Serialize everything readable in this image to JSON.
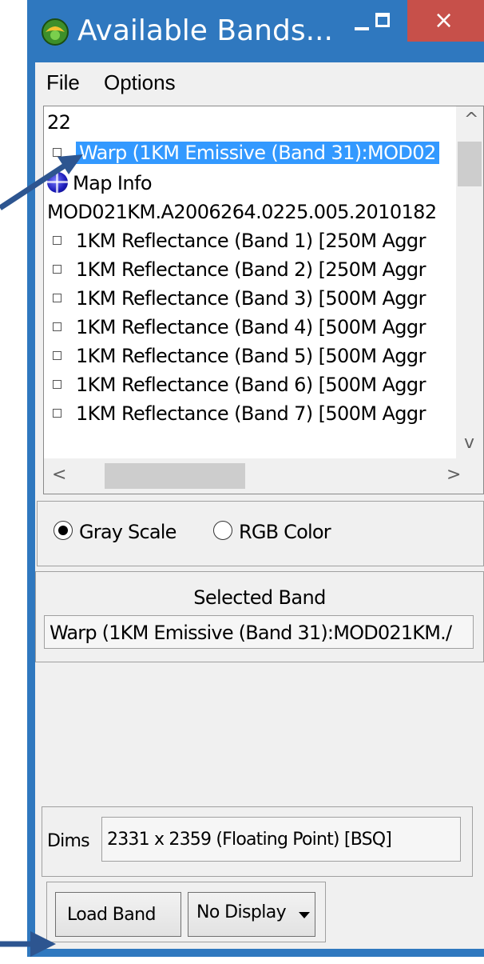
{
  "window": {
    "title": "Available Bands...",
    "close_glyph": "×"
  },
  "menu": {
    "file": "File",
    "options": "Options"
  },
  "band_list": {
    "header": "22",
    "selected_item": "Warp (1KM Emissive (Band 31):MOD02",
    "map_info": "Map Info",
    "file_node": "MOD021KM.A2006264.0225.005.2010182",
    "bands": [
      "1KM Reflectance (Band 1) [250M Aggr",
      "1KM Reflectance (Band 2) [250M Aggr",
      "1KM Reflectance (Band 3) [500M Aggr",
      "1KM Reflectance (Band 4) [500M Aggr",
      "1KM Reflectance (Band 5) [500M Aggr",
      "1KM Reflectance (Band 6) [500M Aggr",
      "1KM Reflectance (Band 7) [500M Aggr"
    ],
    "scroll_up": "^",
    "scroll_down": "v",
    "scroll_left": "<",
    "scroll_right": ">"
  },
  "mode": {
    "gray_scale": "Gray Scale",
    "rgb_color": "RGB Color",
    "selected": "gray_scale"
  },
  "selected_band": {
    "title": "Selected Band",
    "value": "Warp (1KM Emissive (Band 31):MOD021KM./"
  },
  "dims": {
    "label": "Dims",
    "value": "2331 x 2359 (Floating Point) [BSQ]"
  },
  "actions": {
    "load_band": "Load Band",
    "display": "No Display"
  },
  "colors": {
    "window_border": "#2f78bf",
    "close_button": "#c7504a",
    "selection": "#3399ff",
    "annotation_arrow": "#2d5590"
  }
}
